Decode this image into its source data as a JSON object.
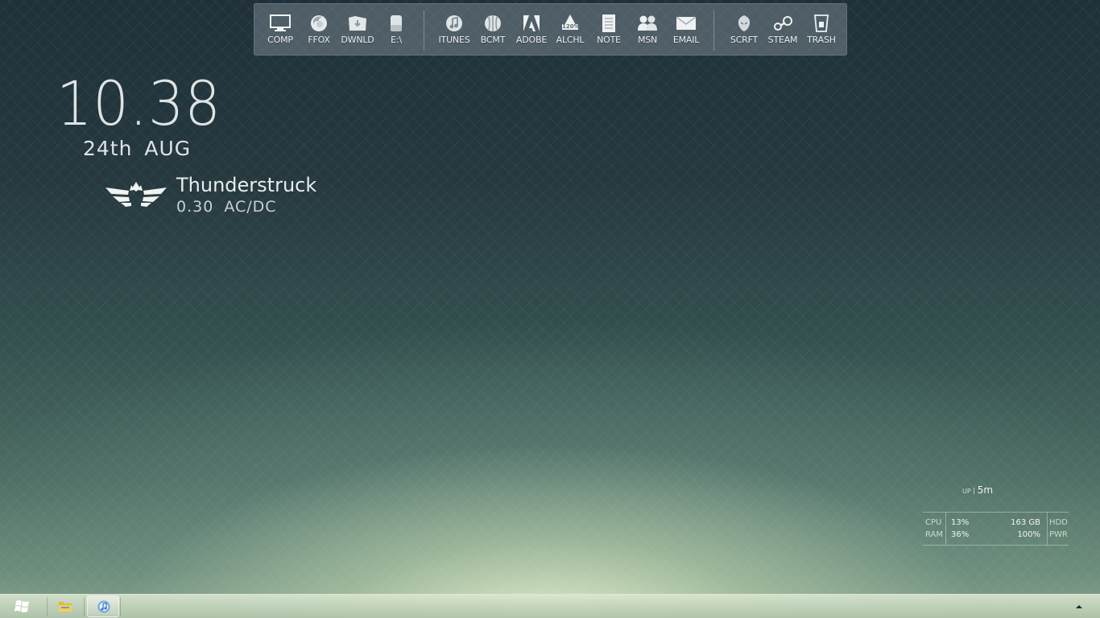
{
  "dock": {
    "items": [
      {
        "label": "COMP",
        "icon": "monitor-icon"
      },
      {
        "label": "FFOX",
        "icon": "firefox-icon"
      },
      {
        "label": "DWNLD",
        "icon": "download-folder-icon"
      },
      {
        "label": "E:\\",
        "icon": "drive-icon"
      },
      {
        "label": "ITUNES",
        "icon": "itunes-icon"
      },
      {
        "label": "BCMT",
        "icon": "bitcomet-icon"
      },
      {
        "label": "ADOBE",
        "icon": "adobe-icon"
      },
      {
        "label": "ALCHL",
        "icon": "alcohol-icon"
      },
      {
        "label": "NOTE",
        "icon": "notepad-icon"
      },
      {
        "label": "MSN",
        "icon": "msn-icon"
      },
      {
        "label": "EMAIL",
        "icon": "envelope-icon"
      },
      {
        "label": "SCRFT",
        "icon": "starcraft-icon"
      },
      {
        "label": "STEAM",
        "icon": "steam-icon"
      },
      {
        "label": "TRASH",
        "icon": "trash-icon"
      }
    ],
    "alchl_badge": "120%"
  },
  "clock": {
    "time": "10.38",
    "date": "24th AUG"
  },
  "music": {
    "title": "Thunderstruck",
    "subtitle": "0.30  AC/DC"
  },
  "system": {
    "uptime_label": "UP",
    "uptime_value": "5m",
    "cpu_label": "CPU",
    "cpu_value": "13%",
    "ram_label": "RAM",
    "ram_value": "36%",
    "hdd_label": "HDD",
    "hdd_value": "163 GB",
    "pwr_label": "PWR",
    "pwr_value": "100%"
  },
  "taskbar": {
    "items": [
      "windows-explorer-icon",
      "itunes-icon"
    ]
  },
  "colors": {
    "text": "#dfe3e4",
    "taskbar": "#c4d4bc"
  }
}
